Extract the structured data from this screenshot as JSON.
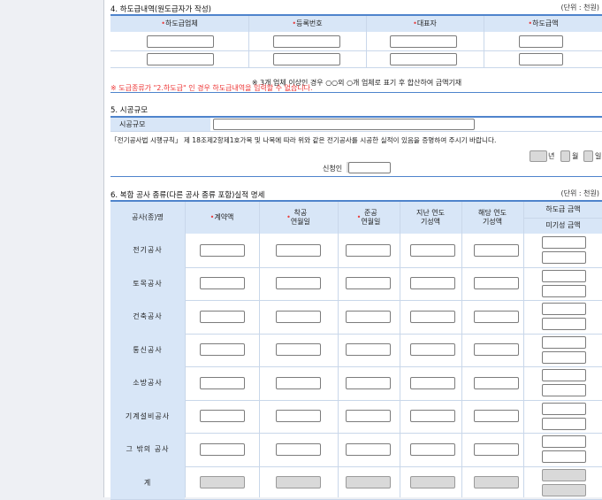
{
  "section4": {
    "title": "4. 하도급내역(원도급자가 작성)",
    "unit": "(단위 : 천원)",
    "columns": [
      "하도급업체",
      "등록번호",
      "대표자",
      "하도급액"
    ],
    "required_mark": "•",
    "note": "※ 3개 업체 이상인 경우 ○○외 ○개 업체로 표기 후 합산하여 금액기재",
    "warning": "※ 도급종류가 \"2.하도급\" 인 경우 하도급내역을 입력할 수 없습니다."
  },
  "section5": {
    "title": "5. 시공규모",
    "row_label": "시공규모",
    "statement": "「전기공사법 시행규칙」 제 18조제2항제1호가목 및 나목에 따라 위와 같은 전기공사를 시공한 실적이 있음을 증명하여 주시기 바랍니다.",
    "date_year": "년",
    "date_month": "월",
    "date_day": "일",
    "applicant_label": "신청인"
  },
  "section6": {
    "title": "6. 복합 공사 종류(다른 공사 종류 포함)실적 명세",
    "unit": "(단위 : 천원)",
    "headers": {
      "type": "공사(종)명",
      "contract": "계약액",
      "start": "착공\n연월일",
      "end": "준공\n연월일",
      "past": "지난 연도\n기성액",
      "current": "해당 연도\n기성액",
      "sub_top": "하도급 금액",
      "sub_bottom": "미기성 금액"
    },
    "rows": [
      "전기공사",
      "토목공사",
      "건축공사",
      "통신공사",
      "소방공사",
      "기계설비공사",
      "그 밖의 공사",
      "계"
    ]
  }
}
